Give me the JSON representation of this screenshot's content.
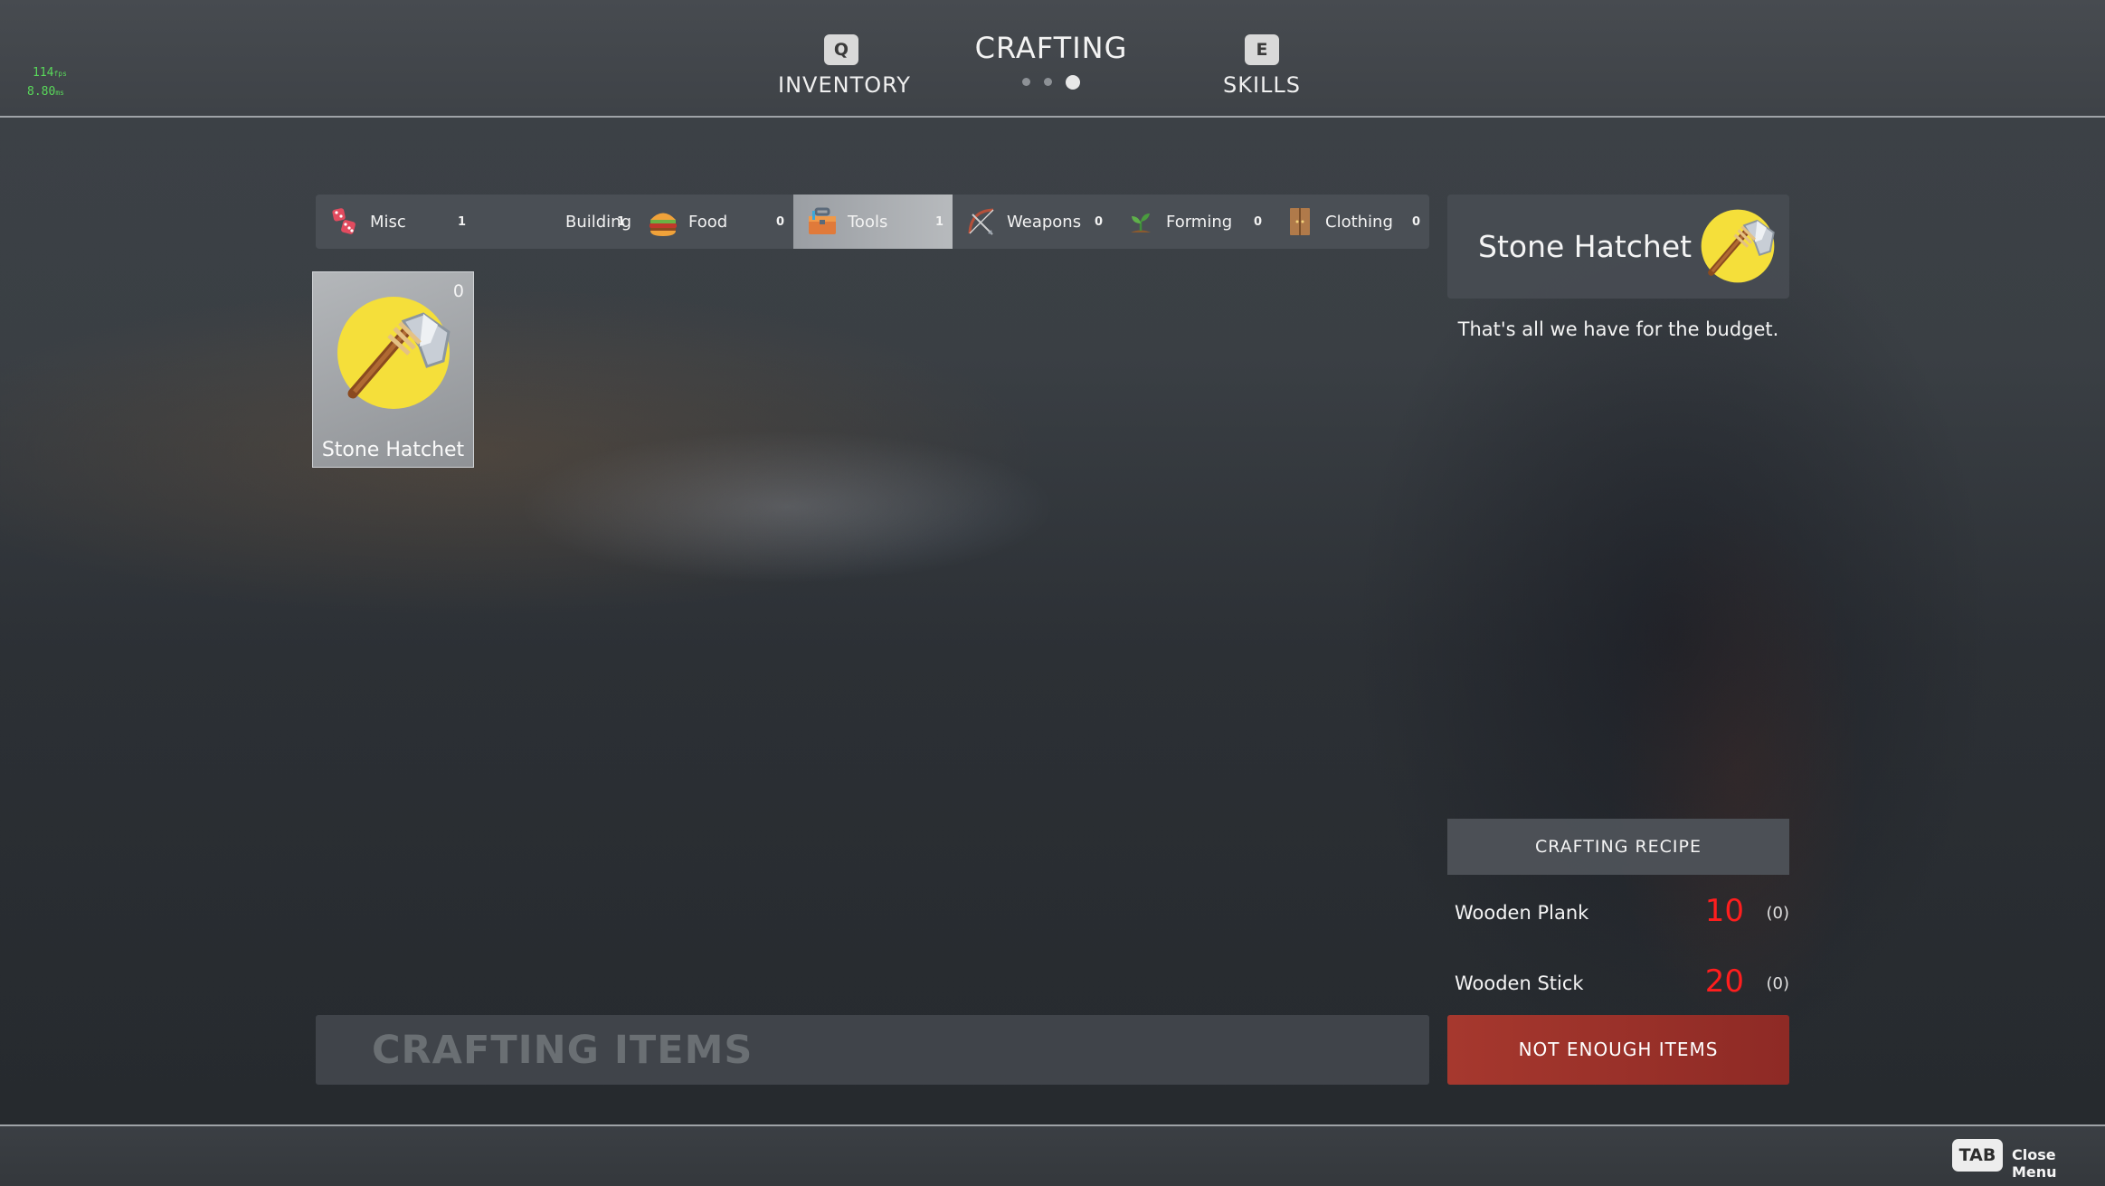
{
  "perf": {
    "fps": "114",
    "fps_unit": "fps",
    "ms": "8.80",
    "ms_unit": "ms"
  },
  "nav": {
    "left": {
      "key": "Q",
      "label": "INVENTORY"
    },
    "center": {
      "label": "CRAFTING",
      "page_dots": 3,
      "active_dot": 3
    },
    "right": {
      "key": "E",
      "label": "SKILLS"
    }
  },
  "categories": [
    {
      "label": "Misc",
      "count": "1",
      "icon": "dice-icon"
    },
    {
      "label": "Building",
      "count": "1",
      "icon": "none"
    },
    {
      "label": "Food",
      "count": "0",
      "icon": "burger-icon"
    },
    {
      "label": "Tools",
      "count": "1",
      "icon": "toolbox-icon",
      "active": true
    },
    {
      "label": "Weapons",
      "count": "0",
      "icon": "bow-icon"
    },
    {
      "label": "Forming",
      "count": "0",
      "icon": "sprout-icon"
    },
    {
      "label": "Clothing",
      "count": "0",
      "icon": "wardrobe-icon"
    }
  ],
  "items": [
    {
      "name": "Stone Hatchet",
      "quantity": "0",
      "icon": "stone-hatchet-icon"
    }
  ],
  "detail": {
    "title": "Stone Hatchet",
    "description": "That's all we have for the budget.",
    "icon": "stone-hatchet-icon"
  },
  "recipe": {
    "header": "CRAFTING RECIPE",
    "ingredients": [
      {
        "name": "Wooden Plank",
        "required": "10",
        "owned": "(0)"
      },
      {
        "name": "Wooden Stick",
        "required": "20",
        "owned": "(0)"
      }
    ],
    "button_label": "NOT ENOUGH ITEMS"
  },
  "crafting_items_label": "CRAFTING ITEMS",
  "footer": {
    "key": "TAB",
    "label": "Close Menu"
  },
  "colors": {
    "accent_red": "#ff1e1e",
    "button_red": "#a6382e",
    "icon_yellow": "#f5df3a"
  }
}
